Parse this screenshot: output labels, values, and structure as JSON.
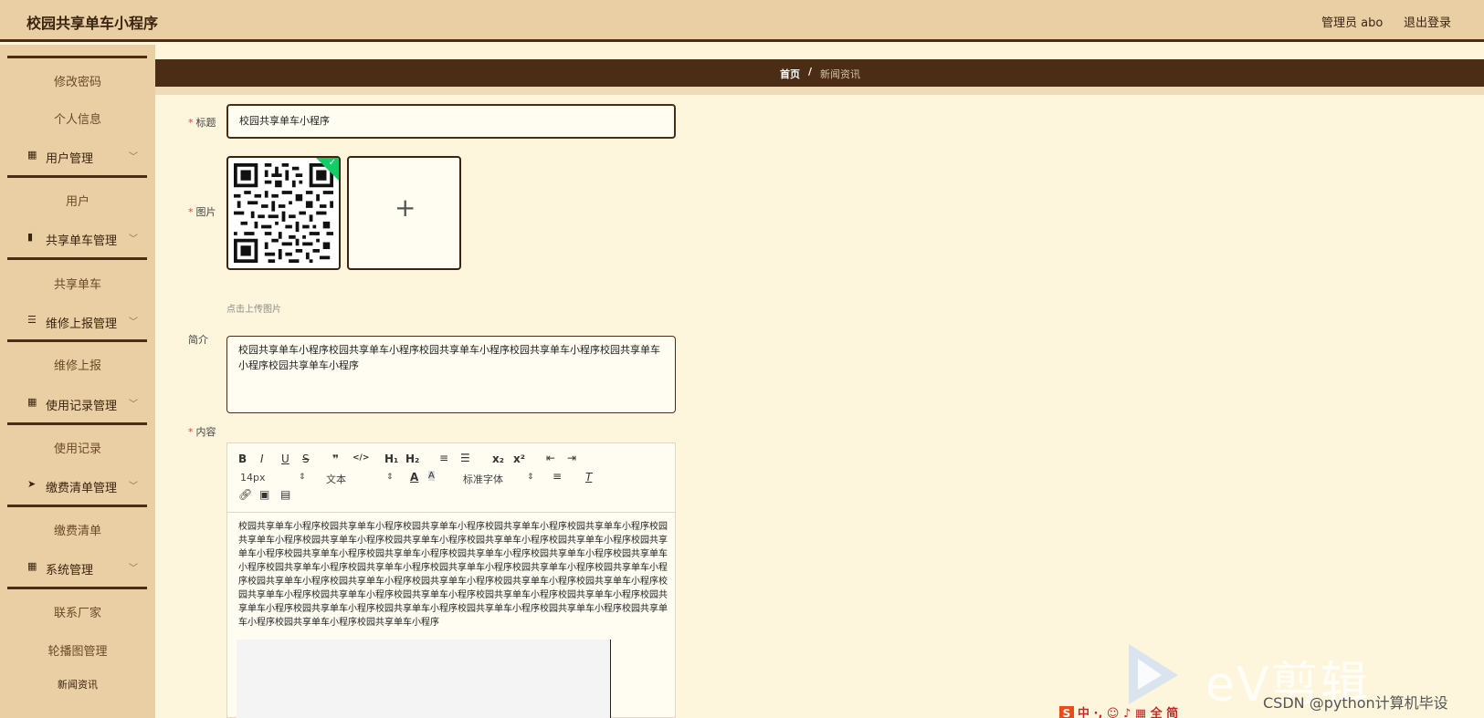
{
  "header": {
    "app_title": "校园共享单车小程序",
    "admin_label": "管理员 abo",
    "logout": "退出登录"
  },
  "sidebar": {
    "items": [
      {
        "label": "修改密码"
      },
      {
        "label": "个人信息"
      },
      {
        "label": "用户管理",
        "icon": "grid-icon"
      },
      {
        "label": "用户"
      },
      {
        "label": "共享单车管理",
        "icon": "book-icon"
      },
      {
        "label": "共享单车"
      },
      {
        "label": "维修上报管理",
        "icon": "list-icon"
      },
      {
        "label": "维修上报"
      },
      {
        "label": "使用记录管理",
        "icon": "apps-icon"
      },
      {
        "label": "使用记录"
      },
      {
        "label": "缴费清单管理",
        "icon": "send-icon"
      },
      {
        "label": "缴费清单"
      },
      {
        "label": "系统管理",
        "icon": "grid-icon"
      },
      {
        "label": "联系厂家"
      },
      {
        "label": "轮播图管理"
      },
      {
        "label": "新闻资讯"
      }
    ]
  },
  "breadcrumb": {
    "home": "首页",
    "separator": "/",
    "current": "新闻资讯"
  },
  "form": {
    "title_label": "标题",
    "title_value": "校园共享单车小程序",
    "image_label": "图片",
    "upload_tip": "点击上传图片",
    "intro_label": "简介",
    "intro_value": "校园共享单车小程序校园共享单车小程序校园共享单车小程序校园共享单车小程序校园共享单车小程序校园共享单车小程序",
    "content_label": "内容"
  },
  "editor": {
    "toolbar": {
      "bold": "B",
      "italic": "I",
      "underline": "U",
      "strike": "S",
      "quote": "❞",
      "code": "</>",
      "h1": "H₁",
      "h2": "H₂",
      "ordered_list": "≡",
      "bullet_list": "☰",
      "subscript": "x₂",
      "superscript": "x²",
      "outdent": "⇤",
      "indent": "⇥",
      "size": "14px",
      "format": "文本",
      "font_color": "A",
      "background_color": "A",
      "font_family": "标准字体",
      "align": "≡",
      "clean": "T"
    },
    "content": "校园共享单车小程序校园共享单车小程序校园共享单车小程序校园共享单车小程序校园共享单车小程序校园共享单车小程序校园共享单车小程序校园共享单车小程序校园共享单车小程序校园共享单车小程序校园共享单车小程序校园共享单车小程序校园共享单车小程序校园共享单车小程序校园共享单车小程序校园共享单车小程序校园共享单车小程序校园共享单车小程序校园共享单车小程序校园共享单车小程序校园共享单车小程序校园共享单车小程序校园共享单车小程序校园共享单车小程序校园共享单车小程序校园共享单车小程序校园共享单车小程序校园共享单车小程序校园共享单车小程序校园共享单车小程序校园共享单车小程序校园共享单车小程序校园共享单车小程序校园共享单车小程序校园共享单车小程序校园共享单车小程序校园共享单车小程序校园共享单车小程序校园共享单车小程序"
  },
  "overlay": {
    "watermark_brand": "eV剪辑",
    "csdn_credit": "CSDN @python计算机毕设",
    "ime_bar": "中 ·, ☺ ♪ ▦ 全 简"
  },
  "colors": {
    "header_bg": "#e9cfa3",
    "dark_brown": "#4a2d14",
    "page_bg": "#fdf6dc",
    "success_green": "#13ce66"
  }
}
